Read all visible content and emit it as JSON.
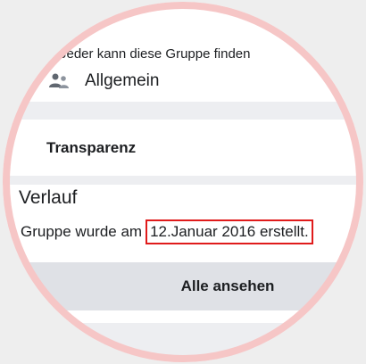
{
  "group_info": {
    "privacy_text": "Jeder kann diese Gruppe finden",
    "type_icon": "people-icon",
    "type_label": "Allgemein"
  },
  "transparency": {
    "title": "Transparenz"
  },
  "history": {
    "title": "Verlauf",
    "created_prefix": "Gruppe wurde am",
    "created_date": "12.Januar 2016 erstellt.",
    "see_all_label": "Alle ansehen"
  },
  "colors": {
    "highlight_border": "#e01b1b",
    "ring": "#f6c6c6",
    "band": "#edeef1",
    "button_band": "#dfe1e6"
  }
}
